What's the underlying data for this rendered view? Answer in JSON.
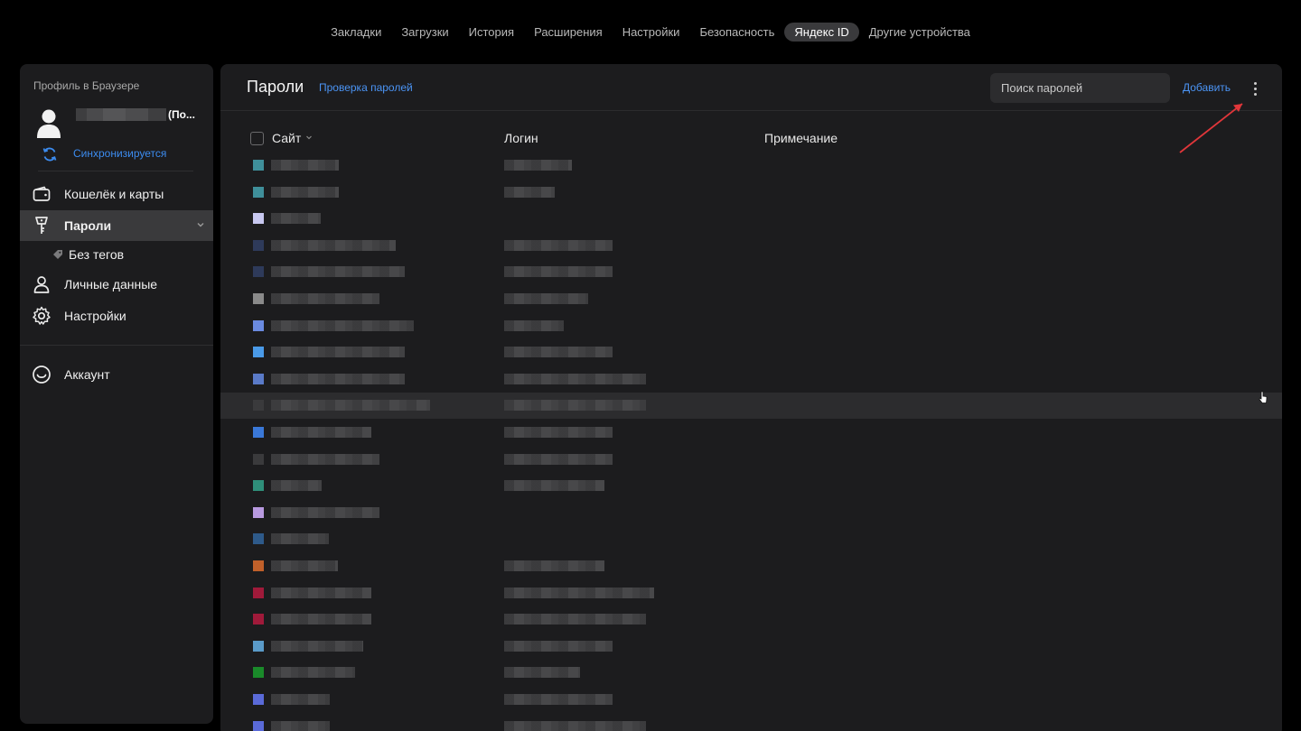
{
  "topnav": {
    "tabs": [
      {
        "label": "Закладки",
        "active": false
      },
      {
        "label": "Загрузки",
        "active": false
      },
      {
        "label": "История",
        "active": false
      },
      {
        "label": "Расширения",
        "active": false
      },
      {
        "label": "Настройки",
        "active": false
      },
      {
        "label": "Безопасность",
        "active": false
      },
      {
        "label": "Яндекс ID",
        "active": true
      },
      {
        "label": "Другие устройства",
        "active": false
      }
    ]
  },
  "sidebar": {
    "profile_caption": "Профиль в Браузере",
    "profile_name_suffix": "(По...",
    "sync_label": "Синхронизируется",
    "items": [
      {
        "label": "Кошелёк и карты",
        "icon": "wallet-icon"
      },
      {
        "label": "Пароли",
        "icon": "key-icon",
        "active": true
      },
      {
        "label": "Без тегов",
        "icon": "tag-icon"
      },
      {
        "label": "Личные данные",
        "icon": "person-icon"
      },
      {
        "label": "Настройки",
        "icon": "gear-icon"
      },
      {
        "label": "Аккаунт",
        "icon": "account-icon"
      }
    ]
  },
  "main": {
    "title": "Пароли",
    "check_link": "Проверка паролей",
    "search_placeholder": "Поиск паролей",
    "add_label": "Добавить",
    "columns": {
      "site": "Сайт",
      "login": "Логин",
      "note": "Примечание"
    },
    "rows": [
      {
        "fav": "#3f8f9a",
        "site_w": 75,
        "login_w": 75
      },
      {
        "fav": "#3f8f9a",
        "site_w": 75,
        "login_w": 56
      },
      {
        "fav": "#c8c8f0",
        "site_w": 55,
        "login_w": 0
      },
      {
        "fav": "#2e3a5a",
        "site_w": 138,
        "login_w": 120
      },
      {
        "fav": "#2e3a5a",
        "site_w": 148,
        "login_w": 120
      },
      {
        "fav": "#8a8a8a",
        "site_w": 120,
        "login_w": 93
      },
      {
        "fav": "#6a8ae0",
        "site_w": 158,
        "login_w": 66
      },
      {
        "fav": "#4a9ae8",
        "site_w": 148,
        "login_w": 120
      },
      {
        "fav": "#5a7ac8",
        "site_w": 148,
        "login_w": 157
      },
      {
        "fav": "#3a3a3c",
        "site_w": 176,
        "login_w": 157,
        "hover": true
      },
      {
        "fav": "#3a78d8",
        "site_w": 111,
        "login_w": 120
      },
      {
        "fav": "#3a3a3c",
        "site_w": 120,
        "login_w": 120
      },
      {
        "fav": "#2f8f7a",
        "site_w": 56,
        "login_w": 111
      },
      {
        "fav": "#b89ae0",
        "site_w": 120,
        "login_w": 0
      },
      {
        "fav": "#2e5a8a",
        "site_w": 64,
        "login_w": 0
      },
      {
        "fav": "#c0602a",
        "site_w": 74,
        "login_w": 111
      },
      {
        "fav": "#a01a3a",
        "site_w": 111,
        "login_w": 166
      },
      {
        "fav": "#a01a3a",
        "site_w": 111,
        "login_w": 157
      },
      {
        "fav": "#5a9ac8",
        "site_w": 102,
        "login_w": 120
      },
      {
        "fav": "#1a8a2a",
        "site_w": 93,
        "login_w": 84
      },
      {
        "fav": "#5a6ad8",
        "site_w": 65,
        "login_w": 120
      },
      {
        "fav": "#5a6ad8",
        "site_w": 65,
        "login_w": 157
      }
    ]
  }
}
